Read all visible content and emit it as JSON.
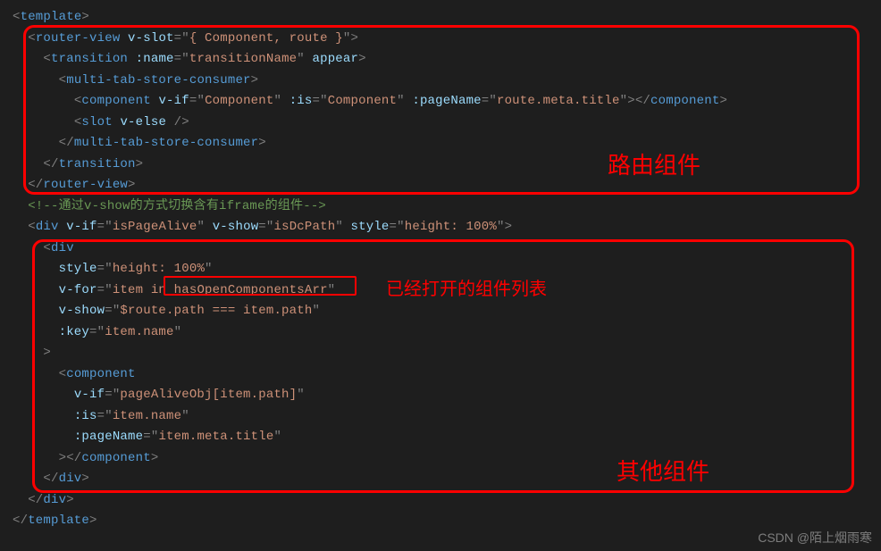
{
  "lines": [
    {
      "i": 0,
      "pre": "&lt;",
      "tag": "template",
      "post": "&gt;"
    },
    {
      "i": 2,
      "pre": "&lt;",
      "tag": "router-view",
      "attrs": [
        {
          "n": "v-slot",
          "v": "{ Component, route }"
        }
      ],
      "post": "&gt;"
    },
    {
      "i": 4,
      "pre": "&lt;",
      "tag": "transition",
      "attrs": [
        {
          "n": ":name",
          "v": "transitionName"
        },
        {
          "n": "appear"
        }
      ],
      "post": "&gt;"
    },
    {
      "i": 6,
      "pre": "&lt;",
      "tag": "multi-tab-store-consumer",
      "post": "&gt;"
    },
    {
      "i": 8,
      "pre": "&lt;",
      "tag": "component",
      "attrs": [
        {
          "n": "v-if",
          "v": "Component"
        },
        {
          "n": ":is",
          "v": "Component"
        },
        {
          "n": ":pageName",
          "v": "route.meta.title"
        }
      ],
      "close": "&gt;&lt;/",
      "closeTag": "component",
      "post": "&gt;"
    },
    {
      "i": 8,
      "pre": "&lt;",
      "tag": "slot",
      "attrs": [
        {
          "n": "v-else"
        }
      ],
      "post": " /&gt;"
    },
    {
      "i": 6,
      "pre": "&lt;/",
      "tag": "multi-tab-store-consumer",
      "post": "&gt;"
    },
    {
      "i": 4,
      "pre": "&lt;/",
      "tag": "transition",
      "post": "&gt;"
    },
    {
      "i": 2,
      "pre": "&lt;/",
      "tag": "router-view",
      "post": "&gt;"
    },
    {
      "i": 2,
      "comment": "&lt;!--通过v-show的方式切换含有iframe的组件--&gt;"
    },
    {
      "i": 2,
      "pre": "&lt;",
      "tag": "div",
      "attrs": [
        {
          "n": "v-if",
          "v": "isPageAlive"
        },
        {
          "n": "v-show",
          "v": "isDcPath"
        },
        {
          "n": "style",
          "v": "height: 100%"
        }
      ],
      "post": "&gt;"
    },
    {
      "i": 4,
      "pre": "&lt;",
      "tag": "div"
    },
    {
      "i": 6,
      "attrOnly": [
        {
          "n": "style",
          "v": "height: 100%"
        }
      ]
    },
    {
      "i": 6,
      "attrOnly": [
        {
          "n": "v-for",
          "v": "item in hasOpenComponentsArr"
        }
      ]
    },
    {
      "i": 6,
      "attrOnly": [
        {
          "n": "v-show",
          "v": "$route.path === item.path"
        }
      ]
    },
    {
      "i": 6,
      "attrOnly": [
        {
          "n": ":key",
          "v": "item.name"
        }
      ]
    },
    {
      "i": 4,
      "rawPunc": "&gt;"
    },
    {
      "i": 6,
      "pre": "&lt;",
      "tag": "component"
    },
    {
      "i": 8,
      "attrOnly": [
        {
          "n": "v-if",
          "v": "pageAliveObj[item.path]"
        }
      ]
    },
    {
      "i": 8,
      "attrOnly": [
        {
          "n": ":is",
          "v": "item.name"
        }
      ]
    },
    {
      "i": 8,
      "attrOnly": [
        {
          "n": ":pageName",
          "v": "item.meta.title"
        }
      ]
    },
    {
      "i": 6,
      "rawPunc": "&gt;&lt;/",
      "closeTag": "component",
      "post": "&gt;"
    },
    {
      "i": 4,
      "pre": "&lt;/",
      "tag": "div",
      "post": "&gt;"
    },
    {
      "i": 2,
      "pre": "&lt;/",
      "tag": "div",
      "post": "&gt;"
    },
    {
      "i": 0,
      "pre": "&lt;/",
      "tag": "template",
      "post": "&gt;"
    }
  ],
  "annotations": {
    "router_label": "路由组件",
    "opened_label": "已经打开的组件列表",
    "other_label": "其他组件"
  },
  "watermark": "CSDN @陌上烟雨寒"
}
